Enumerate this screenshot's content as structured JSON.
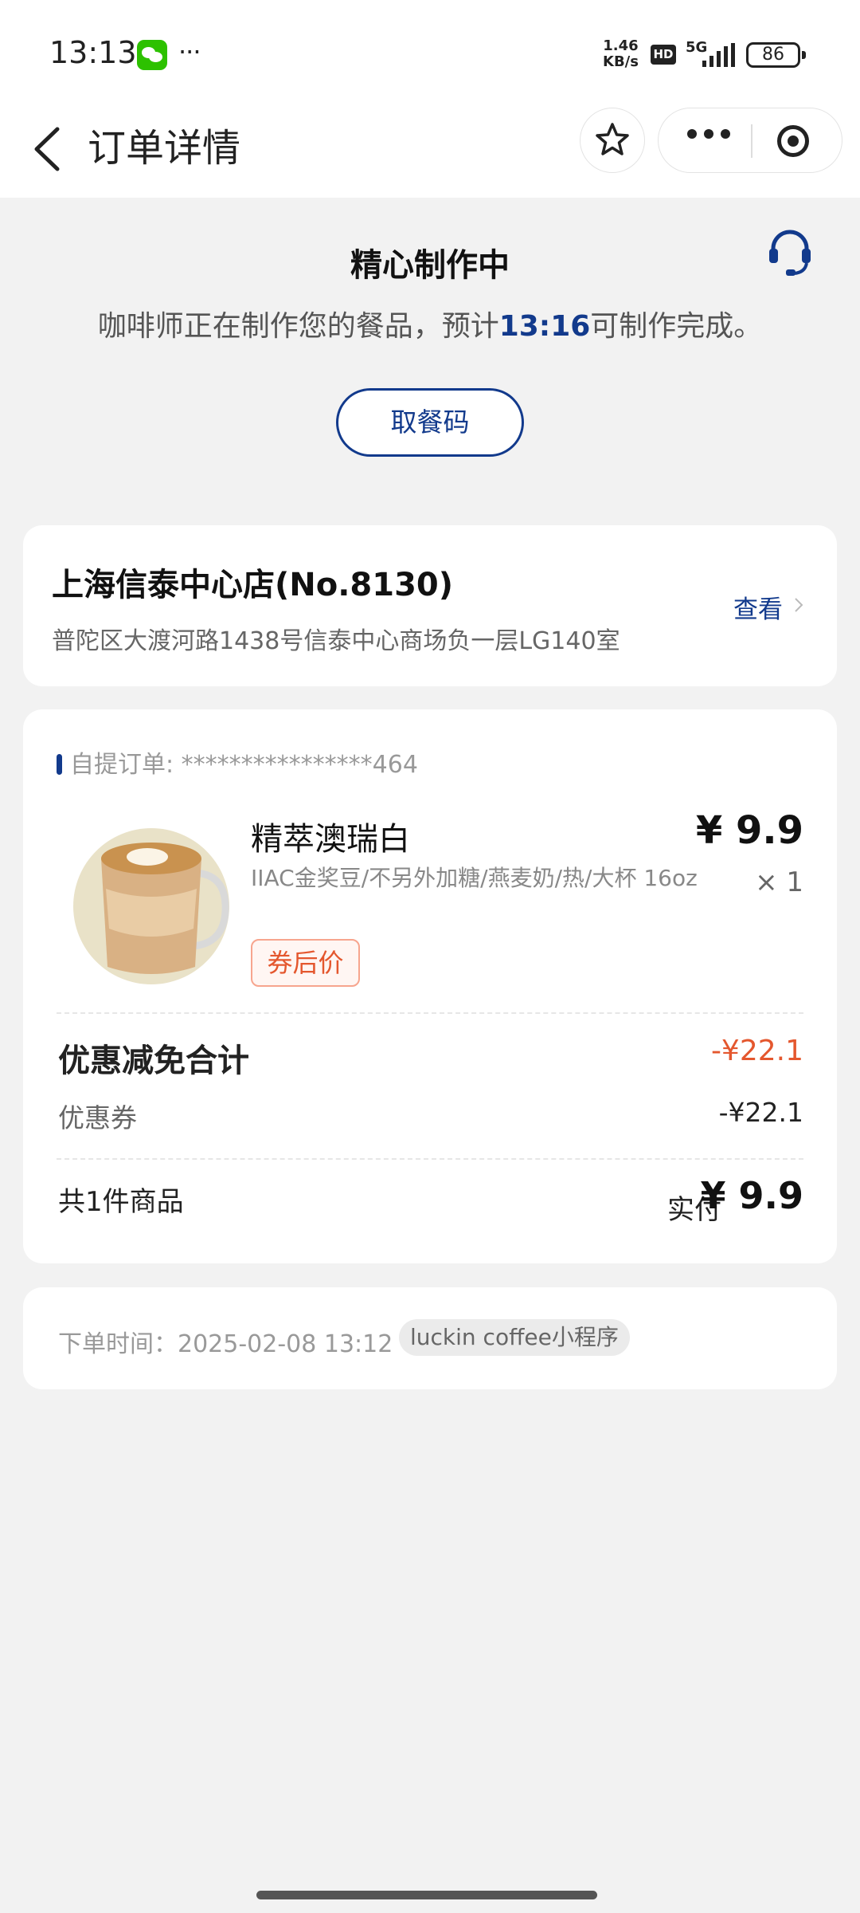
{
  "status_bar": {
    "time": "13:13",
    "app_icon": "wechat-icon",
    "more": "···",
    "speed_value": "1.46",
    "speed_unit": "KB/s",
    "hd": "HD",
    "network": "5G",
    "battery": "86"
  },
  "nav": {
    "title": "订单详情",
    "back_icon": "chevron-left-icon",
    "favorite_icon": "star-icon",
    "more_icon": "more-icon",
    "close_icon": "target-icon"
  },
  "order_status": {
    "title": "精心制作中",
    "text_before": "咖啡师正在制作您的餐品，预计",
    "eta": "13:16",
    "text_after": "可制作完成。",
    "pickup_button": "取餐码",
    "support_icon": "headset-icon",
    "accent_color": "#123a8c"
  },
  "store": {
    "name": "上海信泰中心店(No.8130)",
    "address": "普陀区大渡河路1438号信泰中心商场负一层LG140室",
    "view_link": "查看"
  },
  "order": {
    "type_label": "自提订单:",
    "order_number": "****************464",
    "item": {
      "name": "精萃澳瑞白",
      "specs": "IIAC金奖豆/不另外加糖/燕麦奶/热/大杯 16oz",
      "tag": "券后价",
      "price": "¥ 9.9",
      "quantity": "× 1"
    },
    "discount_title": "优惠减免合计",
    "discount_total": "-¥22.1",
    "coupon_label": "优惠券",
    "coupon_value": "-¥22.1",
    "item_count": "共1件商品",
    "paid_label": "实付",
    "paid_amount": "¥ 9.9",
    "discount_color": "#e4572e"
  },
  "meta": {
    "order_time": "下单时间：2025-02-08 13:12",
    "source": "luckin coffee小程序"
  }
}
